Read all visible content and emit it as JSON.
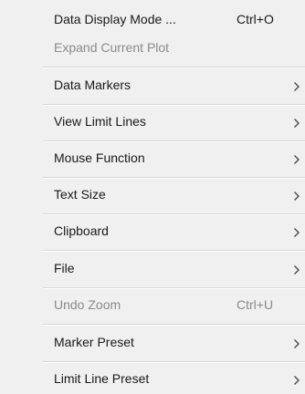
{
  "menu": {
    "items": [
      {
        "label": "Data Display Mode ...",
        "shortcut": "Ctrl+O",
        "submenu": false,
        "enabled": true
      },
      {
        "label": "Expand Current Plot",
        "shortcut": "",
        "submenu": false,
        "enabled": false
      },
      {
        "label": "Data Markers",
        "shortcut": "",
        "submenu": true,
        "enabled": true
      },
      {
        "label": "View Limit Lines",
        "shortcut": "",
        "submenu": true,
        "enabled": true
      },
      {
        "label": "Mouse Function",
        "shortcut": "",
        "submenu": true,
        "enabled": true
      },
      {
        "label": "Text Size",
        "shortcut": "",
        "submenu": true,
        "enabled": true
      },
      {
        "label": "Clipboard",
        "shortcut": "",
        "submenu": true,
        "enabled": true
      },
      {
        "label": "File",
        "shortcut": "",
        "submenu": true,
        "enabled": true
      },
      {
        "label": "Undo Zoom",
        "shortcut": "Ctrl+U",
        "submenu": false,
        "enabled": false
      },
      {
        "label": "Marker Preset",
        "shortcut": "",
        "submenu": true,
        "enabled": true
      },
      {
        "label": "Limit Line Preset",
        "shortcut": "",
        "submenu": true,
        "enabled": true
      }
    ]
  },
  "colors": {
    "menu_background": "#f0f0f0",
    "text": "#1a1a1a",
    "disabled_text": "#8a8a8a",
    "separator": "#d6d6d6"
  }
}
